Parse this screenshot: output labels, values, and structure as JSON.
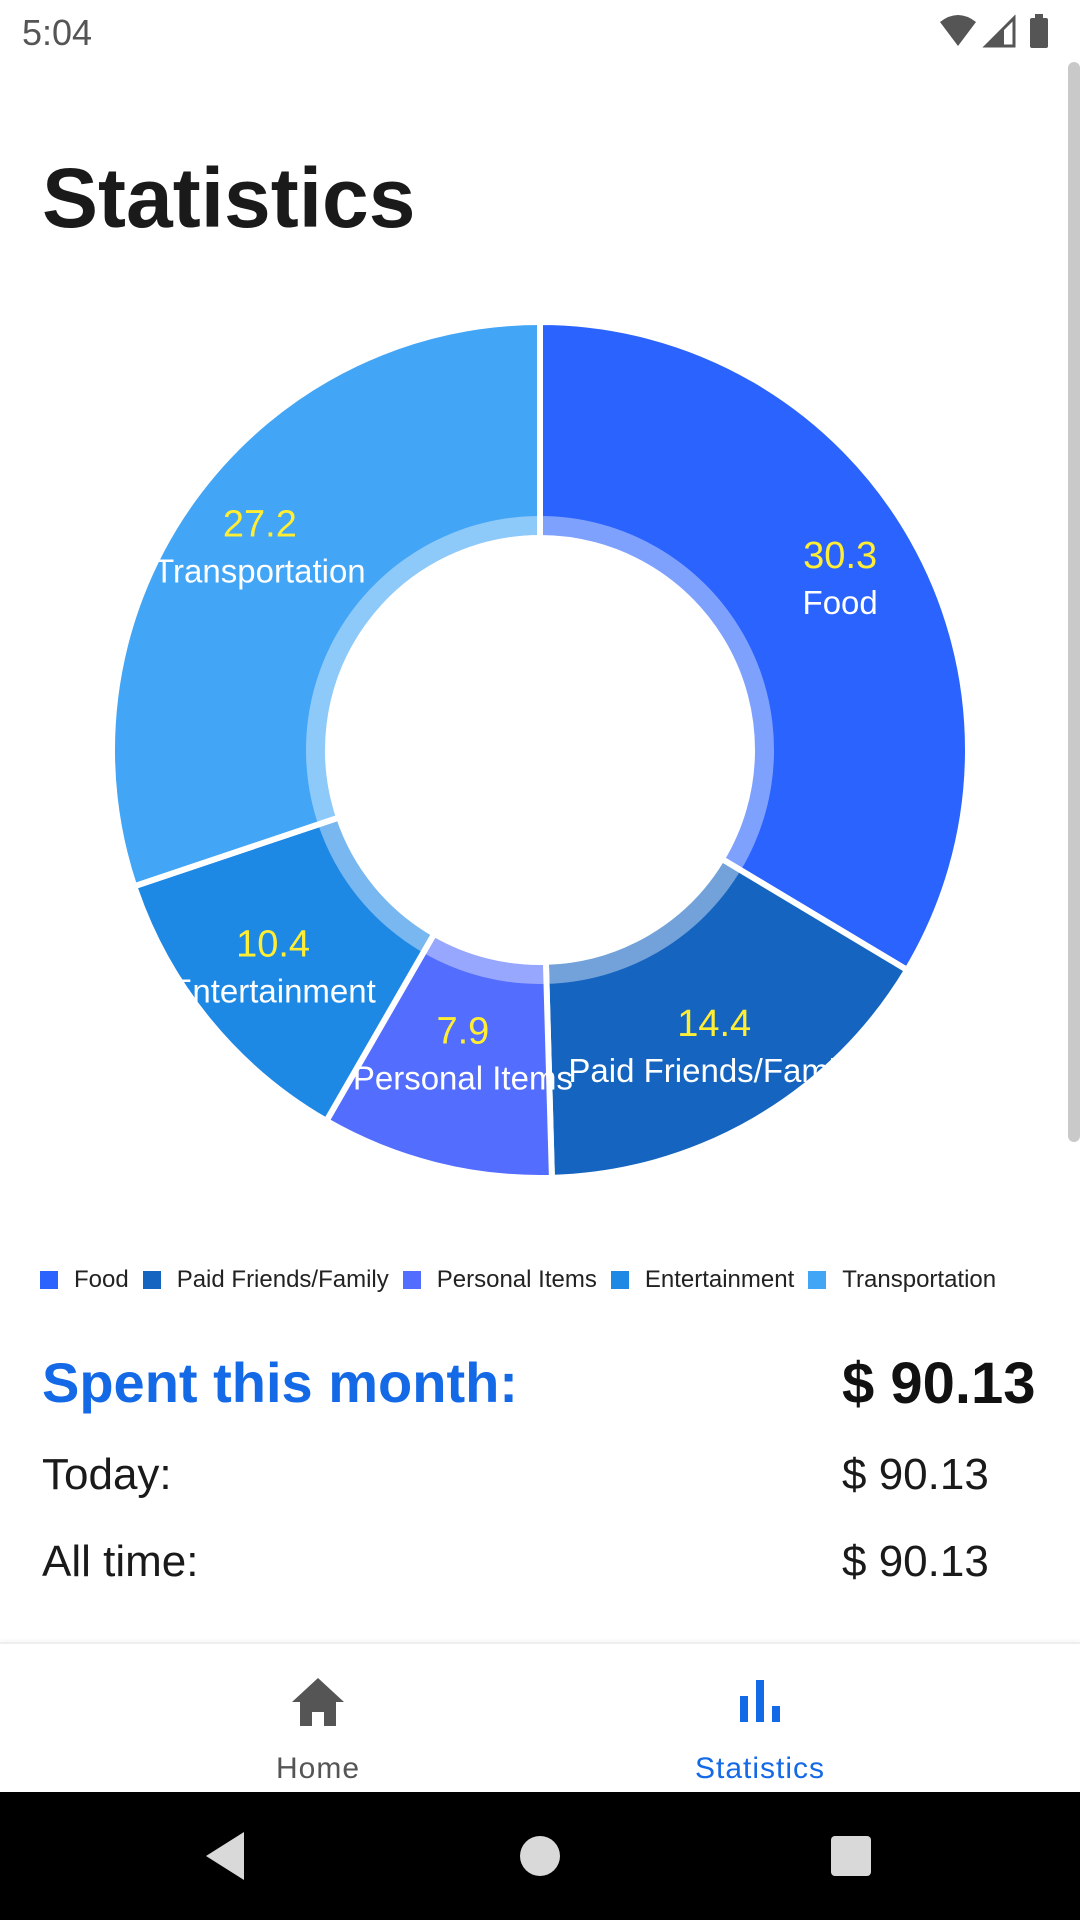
{
  "status_bar": {
    "time": "5:04",
    "icons": [
      "wifi-icon",
      "signal-icon",
      "battery-icon"
    ]
  },
  "page": {
    "title": "Statistics"
  },
  "chart_data": {
    "type": "pie",
    "donut": true,
    "categories": [
      "Food",
      "Paid Friends/Family",
      "Personal Items",
      "Entertainment",
      "Transportation"
    ],
    "values": [
      30.3,
      14.4,
      7.9,
      10.4,
      27.2
    ],
    "value_labels": [
      "30.3",
      "14.4",
      "7.9",
      "10.4",
      "27.2"
    ],
    "slice_labels": [
      "Food",
      "Paid Friends/Family",
      "Personal Items",
      "Entertainment",
      "Transportation"
    ],
    "colors": [
      "#2b63fe",
      "#1565c0",
      "#536dfe",
      "#1e88e5",
      "#42a5f5"
    ],
    "value_label_color": "#ffee33",
    "category_label_color": "#ffffff",
    "legend_position": "bottom"
  },
  "legend": {
    "items": [
      {
        "label": "Food",
        "color": "#2b63fe"
      },
      {
        "label": "Paid Friends/Family",
        "color": "#1565c0"
      },
      {
        "label": "Personal Items",
        "color": "#536dfe"
      },
      {
        "label": "Entertainment",
        "color": "#1e88e5"
      },
      {
        "label": "Transportation",
        "color": "#42a5f5"
      }
    ]
  },
  "summary": {
    "spent_label": "Spent this month:",
    "spent_value": "$ 90.13",
    "today_label": "Today:",
    "today_value": "$ 90.13",
    "all_time_label": "All time:",
    "all_time_value": "$ 90.13"
  },
  "bottom_nav": {
    "tabs": [
      {
        "label": "Home",
        "icon": "home-icon",
        "active": false
      },
      {
        "label": "Statistics",
        "icon": "bar-chart-icon",
        "active": true
      }
    ],
    "active_color": "#1469e6",
    "inactive_color": "#555555"
  },
  "system_nav": {
    "buttons": [
      "back-icon",
      "home-circle-icon",
      "recents-icon"
    ]
  }
}
